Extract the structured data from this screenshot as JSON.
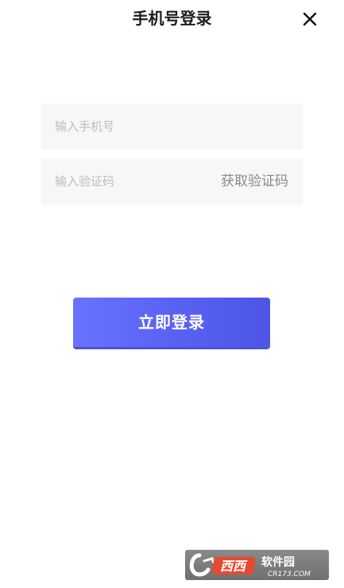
{
  "header": {
    "title": "手机号登录",
    "close_icon": "close-icon"
  },
  "form": {
    "phone_placeholder": "输入手机号",
    "code_placeholder": "输入验证码",
    "get_code_label": "获取验证码",
    "login_label": "立即登录"
  },
  "watermark": {
    "brand": "西西软件园",
    "site": "CR173.COM"
  },
  "colors": {
    "accent": "#5a62f4",
    "field_bg": "#f7f7f7",
    "placeholder": "#bdbdbd"
  }
}
